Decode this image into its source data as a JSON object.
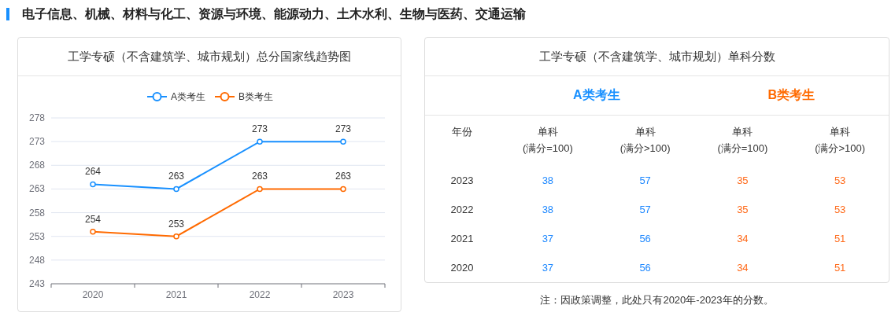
{
  "heading": "电子信息、机械、材料与化工、资源与环境、能源动力、土木水利、生物与医药、交通运输",
  "trend_card": {
    "title": "工学专硕（不含建筑学、城市规划）总分国家线趋势图",
    "chart_data": {
      "type": "line",
      "categories": [
        "2020",
        "2021",
        "2022",
        "2023"
      ],
      "series": [
        {
          "name": "A类考生",
          "color": "#1890ff",
          "marker": "circle",
          "values": [
            264,
            263,
            273,
            273
          ]
        },
        {
          "name": "B类考生",
          "color": "#ff6a00",
          "marker": "circle",
          "values": [
            254,
            253,
            263,
            263
          ]
        }
      ],
      "grid": true,
      "legend": true,
      "ylim": [
        243,
        278
      ],
      "yticks": [
        243,
        248,
        253,
        258,
        263,
        268,
        273,
        278
      ],
      "data_labels": true
    }
  },
  "score_card": {
    "title": "工学专硕（不含建筑学、城市规划）单科分数",
    "groups": [
      {
        "label": "A类考生",
        "color": "#1890ff"
      },
      {
        "label": "B类考生",
        "color": "#ff6a00"
      }
    ],
    "columns": [
      {
        "label": "年份"
      },
      {
        "label": "单科\n(满分=100)",
        "color": "#1e88ff"
      },
      {
        "label": "单科\n(满分>100)",
        "color": "#1e88ff"
      },
      {
        "label": "单科\n(满分=100)",
        "color": "#ff6a1a"
      },
      {
        "label": "单科\n(满分>100)",
        "color": "#ff6a1a"
      }
    ],
    "rows": [
      {
        "cells": [
          "2023",
          "38",
          "57",
          "35",
          "53"
        ]
      },
      {
        "cells": [
          "2022",
          "38",
          "57",
          "35",
          "53"
        ]
      },
      {
        "cells": [
          "2021",
          "37",
          "56",
          "34",
          "51"
        ]
      },
      {
        "cells": [
          "2020",
          "37",
          "56",
          "34",
          "51"
        ]
      }
    ]
  },
  "note": "注：因政策调整，此处只有2020年-2023年的分数。"
}
